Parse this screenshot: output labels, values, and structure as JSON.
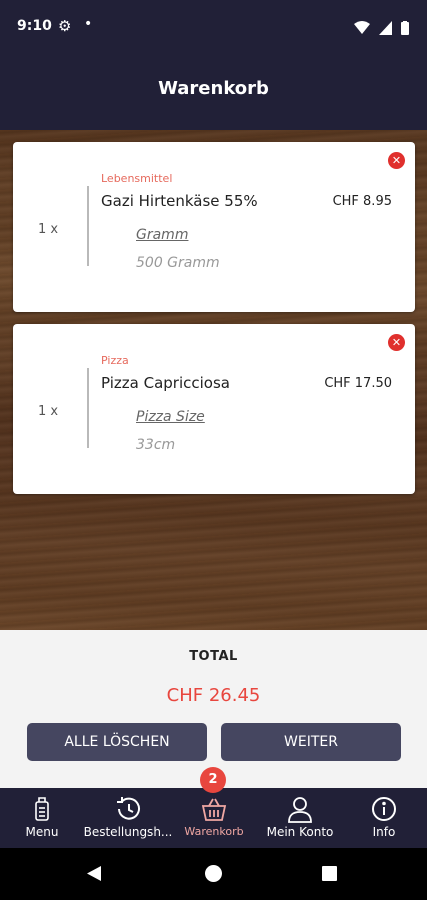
{
  "status_bar": {
    "time": "9:10"
  },
  "header": {
    "title": "Warenkorb"
  },
  "cart_items": [
    {
      "quantity": "1 x",
      "category": "Lebensmittel",
      "name": "Gazi Hirtenkäse 55%",
      "price": "CHF 8.95",
      "option_label": "Gramm",
      "option_value": "500 Gramm"
    },
    {
      "quantity": "1 x",
      "category": "Pizza",
      "name": "Pizza Capricciosa",
      "price": "CHF 17.50",
      "option_label": "Pizza Size",
      "option_value": "33cm"
    }
  ],
  "summary": {
    "total_label": "TOTAL",
    "total_value": "CHF 26.45",
    "clear_label": "ALLE LÖSCHEN",
    "next_label": "WEITER"
  },
  "bottom_nav": {
    "items": [
      {
        "label": "Menu",
        "icon": "menu-card-icon"
      },
      {
        "label": "Bestellungsh...",
        "icon": "history-icon"
      },
      {
        "label": "Warenkorb",
        "icon": "basket-icon"
      },
      {
        "label": "Mein Konto",
        "icon": "user-icon"
      },
      {
        "label": "Info",
        "icon": "info-icon"
      }
    ],
    "cart_badge": "2",
    "active_color": "#f0a7a3"
  },
  "colors": {
    "primary": "#212037",
    "button": "#454660",
    "accent": "#e8463e",
    "category": "#e66a5d"
  }
}
